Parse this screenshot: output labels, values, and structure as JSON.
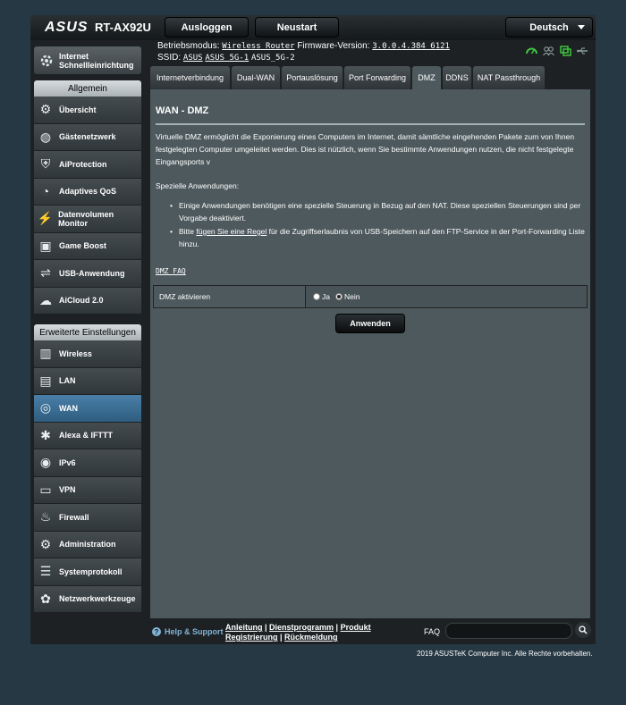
{
  "header": {
    "brand": "ASUS",
    "model": "RT-AX92U",
    "logout_label": "Ausloggen",
    "reboot_label": "Neustart",
    "language": "Deutsch"
  },
  "info": {
    "mode_label": "Betriebsmodus:",
    "mode_value": "Wireless Router",
    "firmware_label": "Firmware-Version:",
    "firmware_value": "3.0.0.4.384_6121",
    "ssid_label": "SSID:",
    "ssids": [
      "ASUS",
      "ASUS_5G-1",
      "ASUS_5G-2"
    ]
  },
  "sidebar": {
    "quick_setup": "Internet Schnellleinrichtung",
    "general_title": "Allgemein",
    "general_items": [
      {
        "label": "Übersicht",
        "icon": "network-map-icon"
      },
      {
        "label": "Gästenetzwerk",
        "icon": "guest-network-icon"
      },
      {
        "label": "AiProtection",
        "icon": "shield-icon"
      },
      {
        "label": "Adaptives QoS",
        "icon": "qos-gauge-icon"
      },
      {
        "label": "Datenvolumen Monitor",
        "icon": "traffic-monitor-icon"
      },
      {
        "label": "Game Boost",
        "icon": "gamepad-icon"
      },
      {
        "label": "USB-Anwendung",
        "icon": "usb-icon"
      },
      {
        "label": "AiCloud 2.0",
        "icon": "cloud-icon"
      }
    ],
    "advanced_title": "Erweiterte Einstellungen",
    "advanced_items": [
      {
        "label": "Wireless",
        "icon": "wifi-icon"
      },
      {
        "label": "LAN",
        "icon": "lan-icon"
      },
      {
        "label": "WAN",
        "icon": "globe-icon"
      },
      {
        "label": "Alexa & IFTTT",
        "icon": "alexa-icon"
      },
      {
        "label": "IPv6",
        "icon": "ipv6-icon"
      },
      {
        "label": "VPN",
        "icon": "vpn-icon"
      },
      {
        "label": "Firewall",
        "icon": "firewall-icon"
      },
      {
        "label": "Administration",
        "icon": "admin-gear-icon"
      },
      {
        "label": "Systemprotokoll",
        "icon": "log-icon"
      },
      {
        "label": "Netzwerkwerkzeuge",
        "icon": "tools-icon"
      }
    ]
  },
  "tabs": [
    "Internetverbindung",
    "Dual-WAN",
    "Portauslösung",
    "Port Forwarding",
    "DMZ",
    "DDNS",
    "NAT Passthrough"
  ],
  "main": {
    "title": "WAN - DMZ",
    "intro": "Virtuelle DMZ ermöglicht die Exponierung eines Computers im Internet, damit sämtliche eingehenden Pakete zum von Ihnen festgelegten Computer umgeleitet werden. Dies ist nützlich, wenn Sie bestimmte Anwendungen nutzen, die nicht festgelegte Eingangsports v",
    "special_head": "Spezielle Anwendungen:",
    "bullet1": "Einige Anwendungen benötigen eine spezielle Steuerung in Bezug auf den NAT. Diese speziellen Steuerungen sind per Vorgabe deaktiviert.",
    "bullet2_pre": "Bitte ",
    "bullet2_link": "fügen Sie eine Regel",
    "bullet2_post": " für die Zugriffserlaubnis von USB-Speichern auf den FTP-Service in der Port-Forwarding Liste hinzu.",
    "faq_link": "DMZ FAQ",
    "dmz_label": "DMZ aktivieren",
    "opt_yes": "Ja",
    "opt_no": "Nein",
    "apply_label": "Anwenden"
  },
  "footer": {
    "help": "Help & Support",
    "link_manual": "Anleitung",
    "link_utility": "Dienstprogramm",
    "link_product_reg": "Produkt Registrierung",
    "link_feedback": "Rückmeldung",
    "faq_label": "FAQ",
    "copyright": "2019 ASUSTeK Computer Inc. Alle Rechte vorbehalten."
  }
}
